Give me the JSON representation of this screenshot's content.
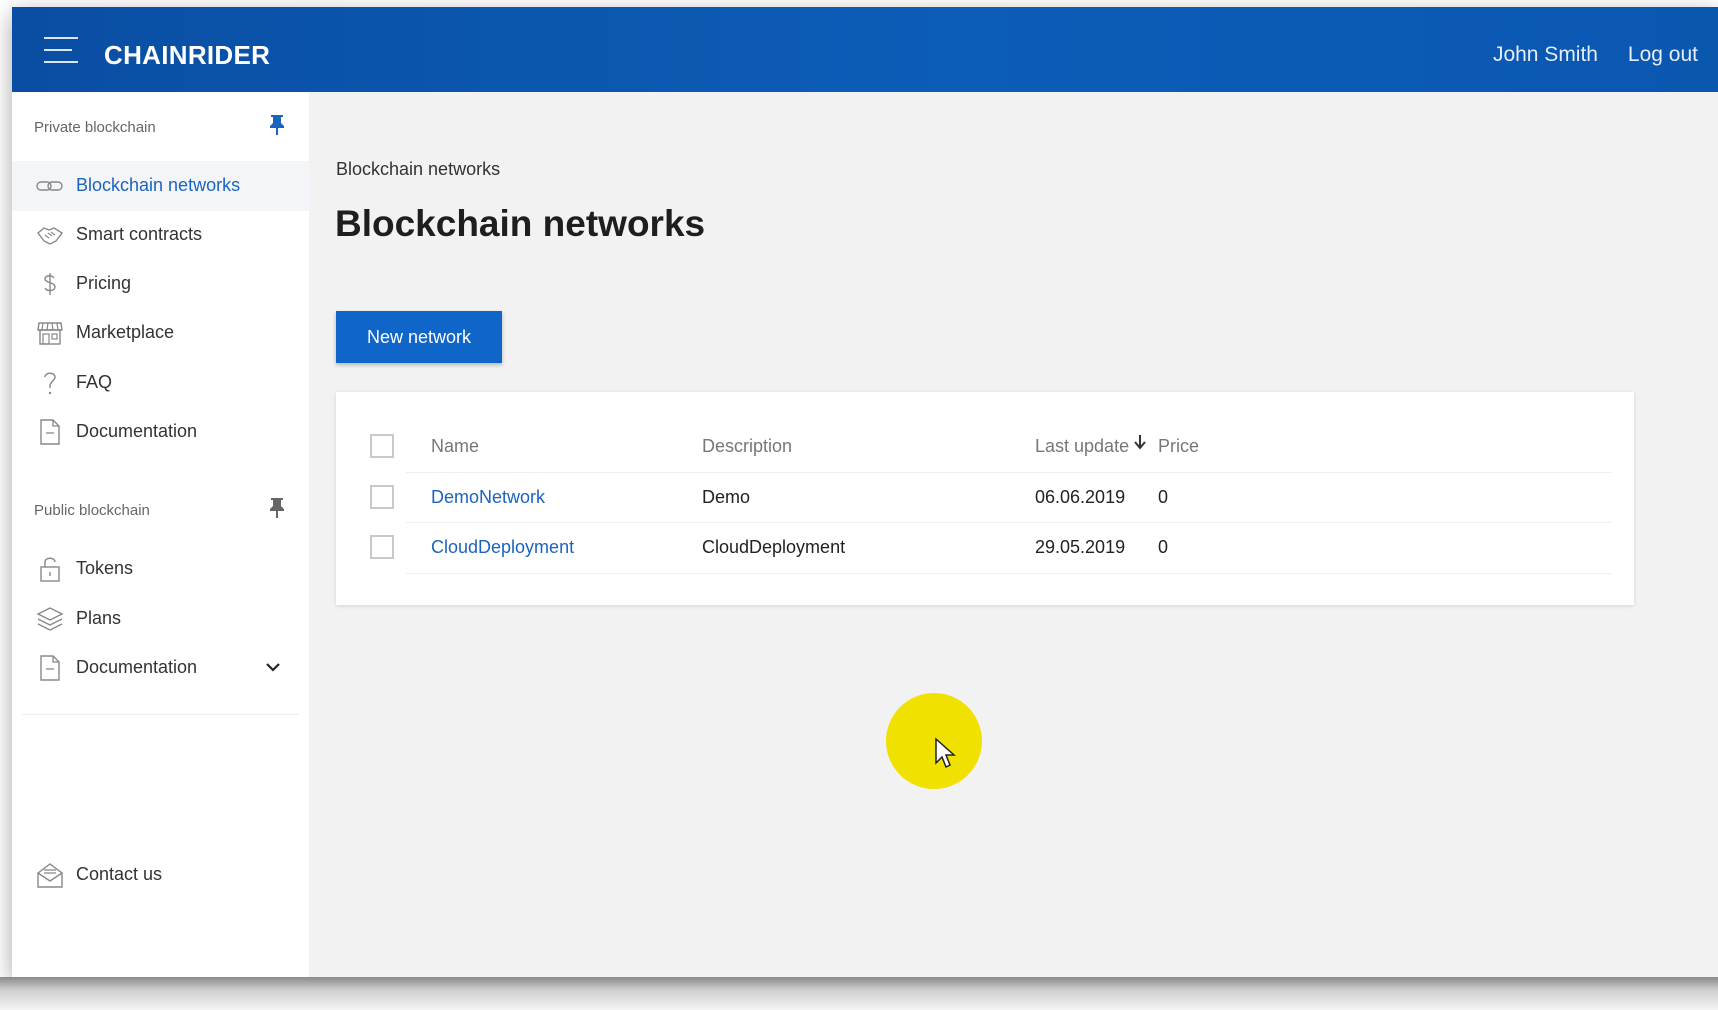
{
  "topbar": {
    "brand": "CHAINRIDER",
    "user_name": "John Smith",
    "logout_label": "Log out"
  },
  "sidebar": {
    "private_heading": "Private blockchain",
    "private_items": [
      {
        "label": "Blockchain networks",
        "icon": "chain-link-icon",
        "active": true
      },
      {
        "label": "Smart contracts",
        "icon": "handshake-icon"
      },
      {
        "label": "Pricing",
        "icon": "dollar-icon"
      },
      {
        "label": "Marketplace",
        "icon": "storefront-icon"
      },
      {
        "label": "FAQ",
        "icon": "question-icon"
      },
      {
        "label": "Documentation",
        "icon": "document-icon"
      }
    ],
    "public_heading": "Public blockchain",
    "public_items": [
      {
        "label": "Tokens",
        "icon": "lock-icon"
      },
      {
        "label": "Plans",
        "icon": "layers-icon"
      },
      {
        "label": "Documentation",
        "icon": "document-icon"
      }
    ],
    "contact_label": "Contact us"
  },
  "main": {
    "breadcrumb": "Blockchain networks",
    "title": "Blockchain networks",
    "new_button_label": "New network",
    "table": {
      "columns": [
        "Name",
        "Description",
        "Last update",
        "Price"
      ],
      "rows": [
        {
          "name": "DemoNetwork",
          "description": "Demo",
          "last_update": "06.06.2019",
          "price": "0"
        },
        {
          "name": "CloudDeployment",
          "description": "CloudDeployment",
          "last_update": "29.05.2019",
          "price": "0"
        }
      ]
    }
  },
  "colors": {
    "header_blue": "#0c5db8",
    "accent_blue": "#0f66c8",
    "link_blue": "#1a64c0",
    "cursor_highlight": "#f0e100"
  }
}
